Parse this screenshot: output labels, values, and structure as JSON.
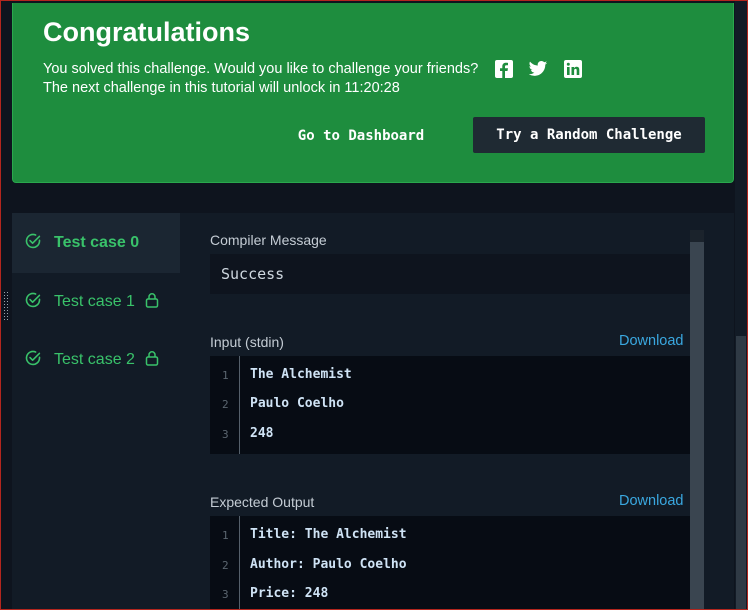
{
  "banner": {
    "title": "Congratulations",
    "message": "You solved this challenge. Would you like to challenge your friends?",
    "unlock_message": "The next challenge in this tutorial will unlock in 11:20:28",
    "dashboard_button": "Go to Dashboard",
    "random_button": "Try a Random Challenge",
    "social_icons": [
      "facebook-icon",
      "twitter-icon",
      "linkedin-icon"
    ]
  },
  "test_cases": [
    {
      "label": "Test case 0",
      "active": true,
      "locked": false
    },
    {
      "label": "Test case 1",
      "active": false,
      "locked": true
    },
    {
      "label": "Test case 2",
      "active": false,
      "locked": true
    }
  ],
  "compiler": {
    "label": "Compiler Message",
    "message": "Success"
  },
  "input": {
    "label": "Input (stdin)",
    "download": "Download",
    "lines": [
      {
        "num": "1",
        "text": "The Alchemist"
      },
      {
        "num": "2",
        "text": "Paulo Coelho"
      },
      {
        "num": "3",
        "text": "248"
      }
    ]
  },
  "expected": {
    "label": "Expected Output",
    "download": "Download",
    "lines": [
      {
        "num": "1",
        "text": "Title: The Alchemist"
      },
      {
        "num": "2",
        "text": "Author: Paulo Coelho"
      },
      {
        "num": "3",
        "text": "Price: 248"
      }
    ]
  },
  "colors": {
    "banner_bg": "#1e8d3e",
    "active_green": "#39c26a",
    "link_blue": "#3aa8e0",
    "page_bg": "#0e141e"
  }
}
